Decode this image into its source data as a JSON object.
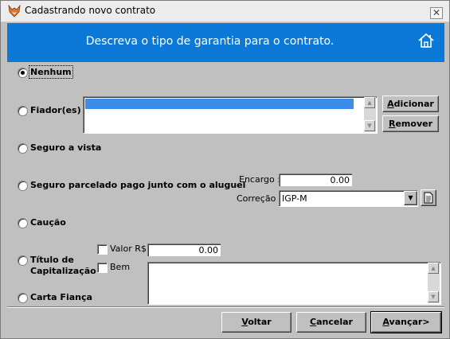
{
  "window": {
    "title": "Cadastrando novo contrato",
    "close_symbol": "✕"
  },
  "banner": {
    "text": "Descreva o tipo de garantia para o contrato."
  },
  "options": {
    "nenhum": "Nenhum",
    "fiador": "Fiador(es)",
    "seguro_vista": "Seguro a vista",
    "seguro_parcelado": "Seguro parcelado pago junto com o aluguel",
    "caucao": "Caução",
    "titulo_line1": "Título de",
    "titulo_line2": "Capitalização",
    "carta_fianca": "Carta Fiança"
  },
  "selected_option": "Nenhum",
  "fiador": {
    "add_prefix": "A",
    "add_rest": "dicionar",
    "remove_prefix": "R",
    "remove_rest": "emover"
  },
  "seguro": {
    "encargo_label": "Encargo :",
    "encargo_value": "0.00",
    "correcao_label": "Correção :",
    "correcao_value": "IGP-M"
  },
  "titulo": {
    "valor_label": "Valor R$",
    "valor_value": "0.00",
    "bem_label": "Bem"
  },
  "footer": {
    "voltar_prefix": "V",
    "voltar_rest": "oltar",
    "cancelar_prefix": "C",
    "cancelar_rest": "ancelar",
    "avancar_prefix": "A",
    "avancar_rest": "vançar>"
  },
  "icons": [
    "fox-app-icon",
    "home-icon",
    "close-icon",
    "scroll-up-icon",
    "scroll-down-icon",
    "dropdown-arrow-icon",
    "document-icon"
  ],
  "colors": {
    "banner": "#0c79d8",
    "selection": "#3d8de8",
    "dialog": "#c0c0c0"
  }
}
